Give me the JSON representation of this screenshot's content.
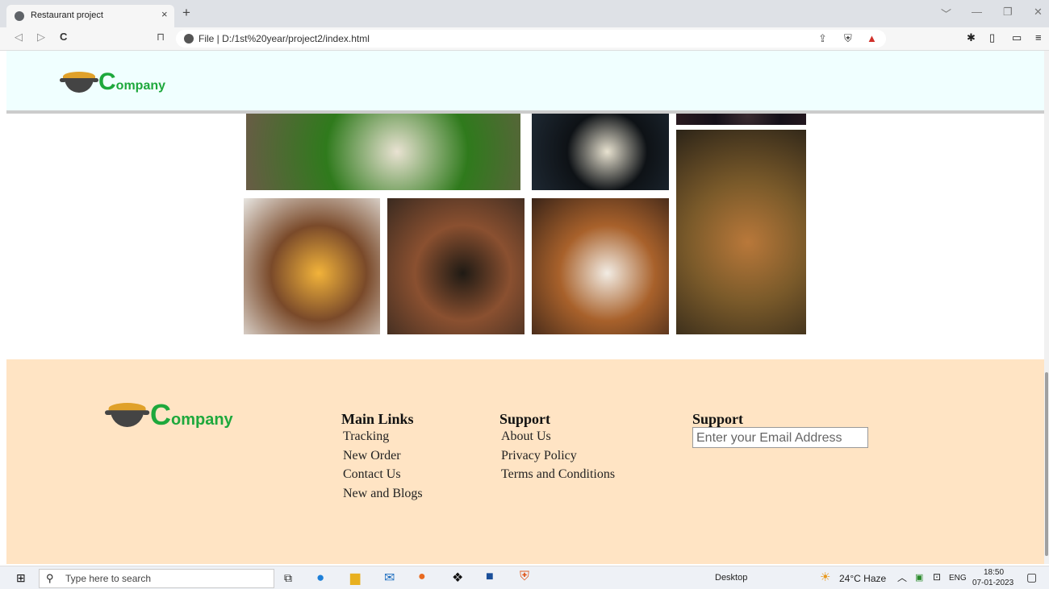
{
  "browser": {
    "tab_title": "Restaurant project",
    "tab_close": "×",
    "new_tab": "+",
    "url_prefix": "File",
    "url": "D:/1st%20year/project2/index.html",
    "window_controls": [
      "﹀",
      "—",
      "❐",
      "✕"
    ]
  },
  "header": {
    "logo_initial": "C",
    "logo_rest": "ompany"
  },
  "gallery": {
    "images": [
      {
        "name": "banana-leaf-meal",
        "colors": [
          "#6a5b47",
          "#2f7a1c",
          "#e9e2d2"
        ]
      },
      {
        "name": "dosa-plate",
        "colors": [
          "#1f2a35",
          "#0e1216",
          "#e8e2d0"
        ]
      },
      {
        "name": "dark-top-strip",
        "colors": [
          "#2a1a20",
          "#15101a",
          "#3a2a30"
        ]
      },
      {
        "name": "curry-brass-pot",
        "colors": [
          "#2c2418",
          "#7a5a2a",
          "#b9783a"
        ]
      },
      {
        "name": "egg-toast",
        "colors": [
          "#e8e6e2",
          "#7a4a2a",
          "#f2b33a"
        ]
      },
      {
        "name": "sizzler-platter",
        "colors": [
          "#3a2a20",
          "#8a5030",
          "#1f1a14"
        ]
      },
      {
        "name": "cream-cupcakes",
        "colors": [
          "#3a2418",
          "#a8612b",
          "#f2ece4"
        ]
      }
    ]
  },
  "footer": {
    "logo_initial": "C",
    "logo_rest": "ompany",
    "main_links": {
      "heading": "Main Links",
      "items": [
        "Tracking",
        "New Order",
        "Contact Us",
        "New and Blogs"
      ]
    },
    "support_links": {
      "heading": "Support",
      "items": [
        "About Us",
        "Privacy Policy",
        "Terms and Conditions"
      ]
    },
    "newsletter": {
      "heading": "Support",
      "placeholder": "Enter your Email Address"
    }
  },
  "taskbar": {
    "search_placeholder": "Type here to search",
    "desktop_label": "Desktop",
    "weather": "24°C  Haze",
    "language": "ENG",
    "time": "18:50",
    "date": "07-01-2023"
  },
  "colors": {
    "header_bg": "#f0ffff",
    "footer_bg": "#ffe4c4",
    "logo_green": "#1ea83c"
  }
}
